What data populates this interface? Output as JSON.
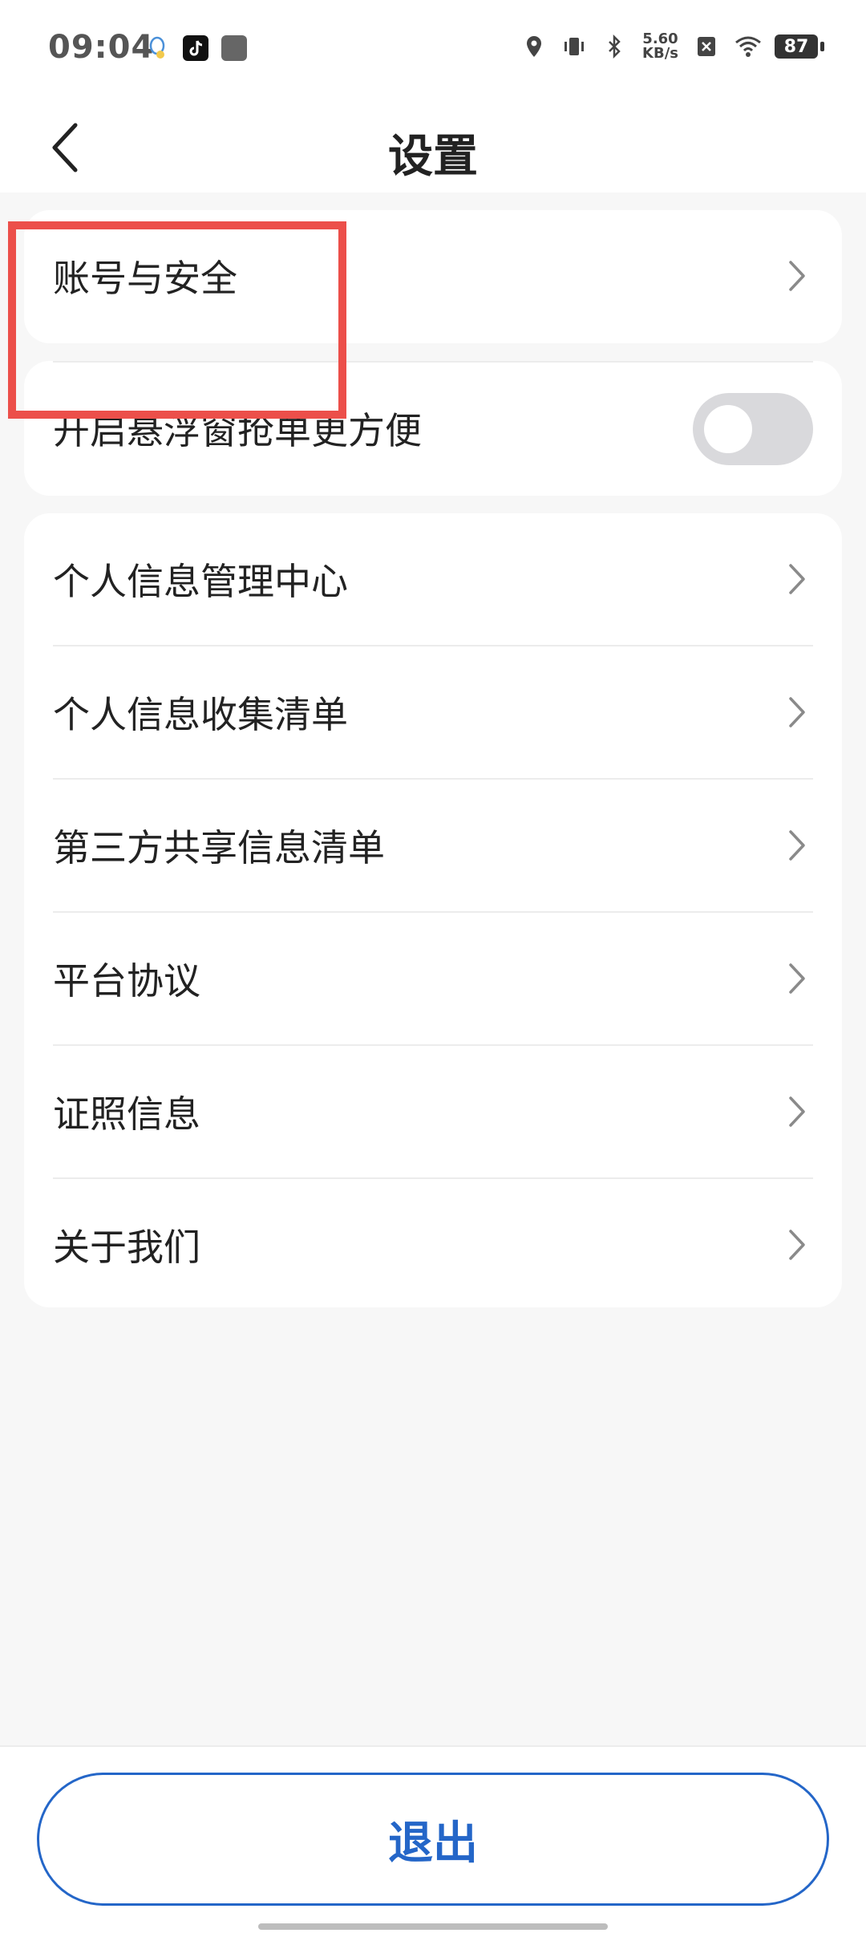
{
  "status_bar": {
    "time": "09:04",
    "net_speed_value": "5.60",
    "net_speed_unit": "KB/s",
    "battery": "87"
  },
  "header": {
    "title": "设置"
  },
  "settings": {
    "account_security": "账号与安全",
    "floating_window": {
      "label": "开启悬浮窗抢单更方便",
      "enabled": false
    },
    "items": [
      "个人信息管理中心",
      "个人信息收集清单",
      "第三方共享信息清单",
      "平台协议",
      "证照信息",
      "关于我们"
    ]
  },
  "footer": {
    "logout_label": "退出"
  },
  "colors": {
    "accent": "#2466c8",
    "highlight": "#ec4f4a",
    "toggle_off": "#d9d9dc"
  }
}
